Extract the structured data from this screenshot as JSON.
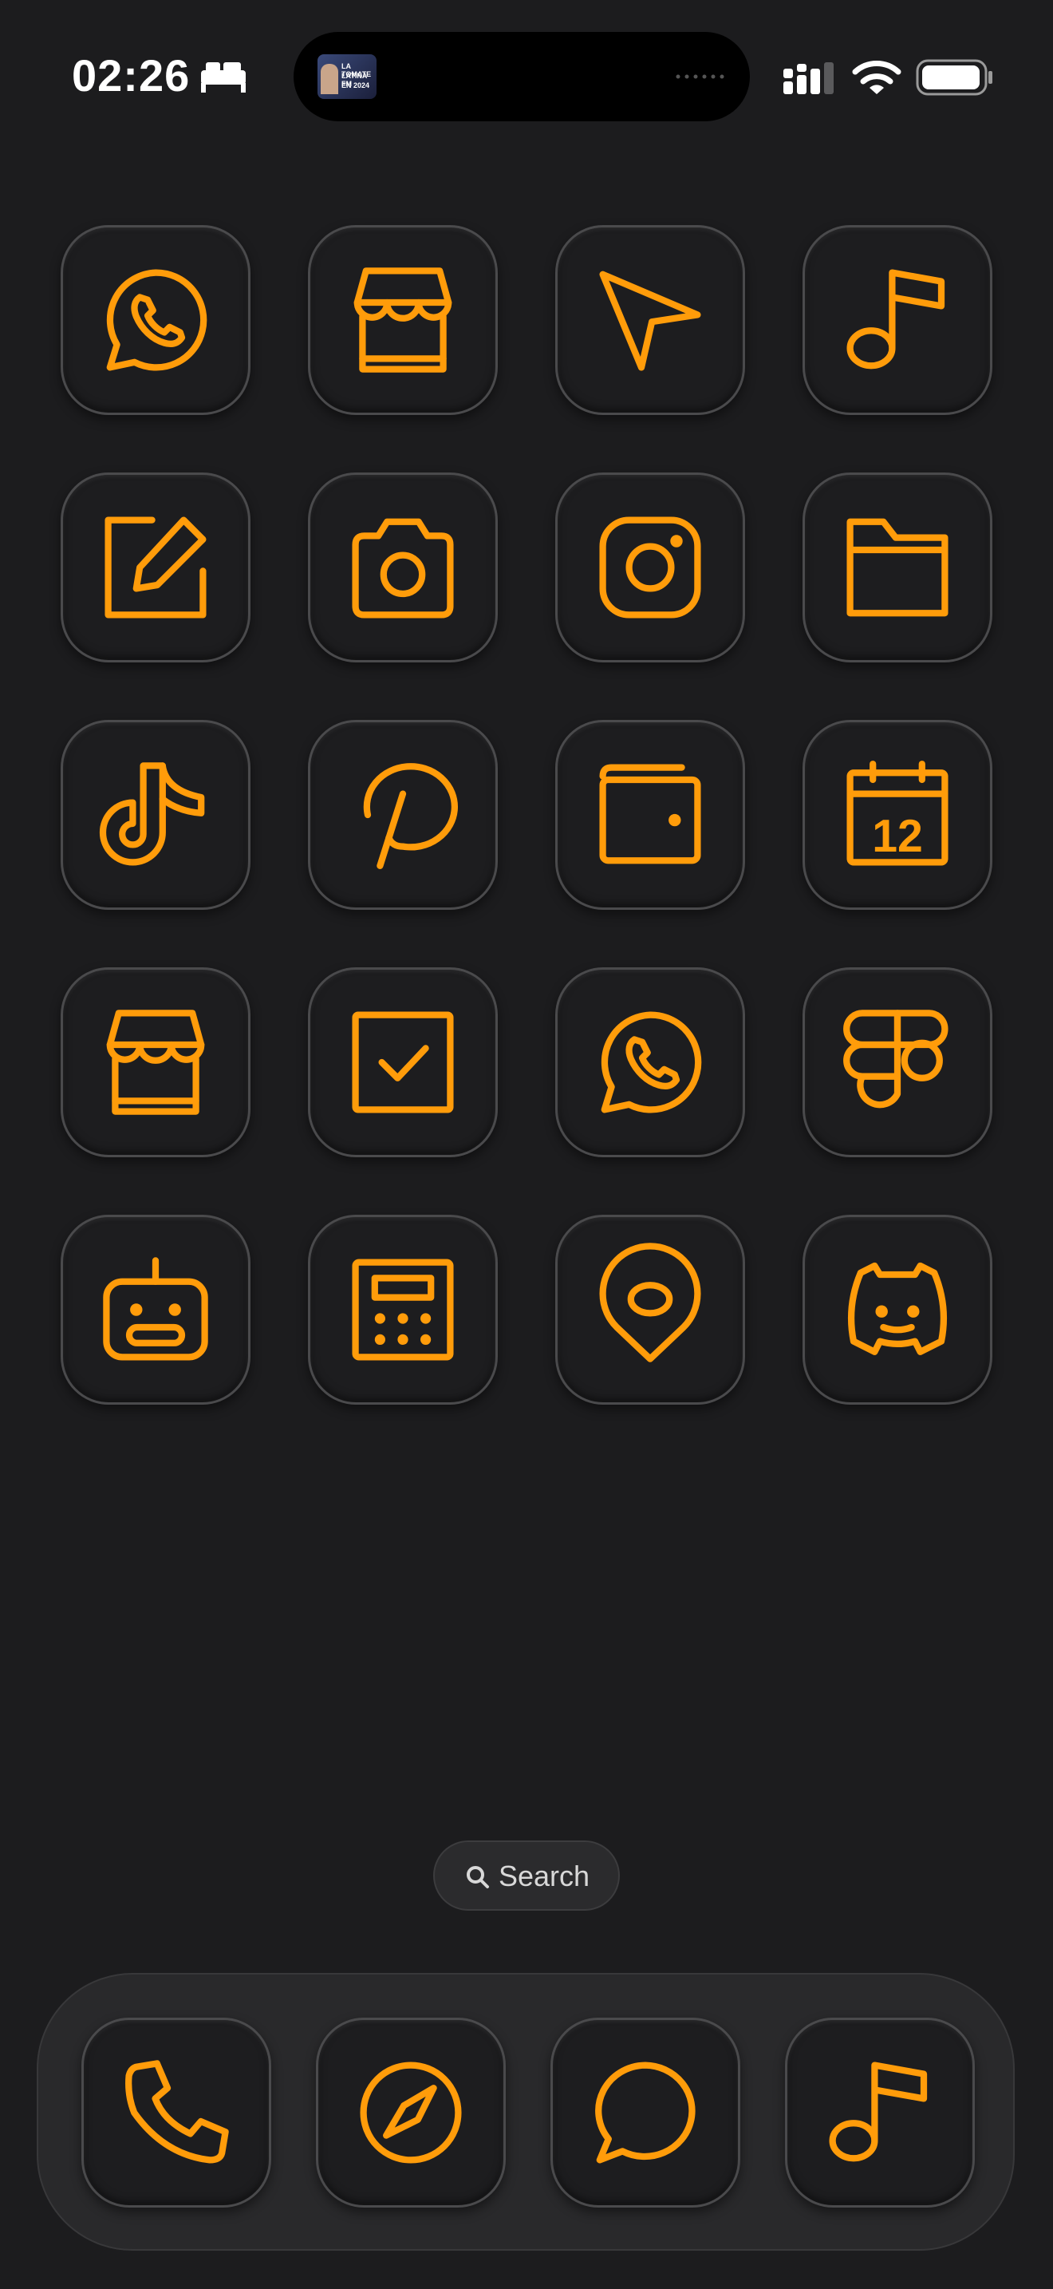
{
  "status_bar": {
    "time": "02:26",
    "sleep_icon": "bed-icon",
    "island_art_text": [
      "LA TOMATE",
      "LATINA FM",
      "EN 2024"
    ],
    "cellular_icon": "signal-icon",
    "wifi_icon": "wifi-icon",
    "battery_icon": "battery-icon"
  },
  "accent_color": "#ff9c0a",
  "home_apps": [
    {
      "icon": "whatsapp-icon"
    },
    {
      "icon": "store-icon"
    },
    {
      "icon": "location-arrow-icon"
    },
    {
      "icon": "music-note-icon"
    },
    {
      "icon": "notes-edit-icon"
    },
    {
      "icon": "camera-icon"
    },
    {
      "icon": "instagram-icon"
    },
    {
      "icon": "folder-icon"
    },
    {
      "icon": "tiktok-icon"
    },
    {
      "icon": "pinterest-icon"
    },
    {
      "icon": "wallet-icon"
    },
    {
      "icon": "calendar-icon",
      "badge_text": "12"
    },
    {
      "icon": "store-icon"
    },
    {
      "icon": "checkbox-icon"
    },
    {
      "icon": "whatsapp-icon"
    },
    {
      "icon": "figma-icon"
    },
    {
      "icon": "robot-icon"
    },
    {
      "icon": "calculator-icon"
    },
    {
      "icon": "map-pin-icon"
    },
    {
      "icon": "discord-icon"
    }
  ],
  "search": {
    "label": "Search",
    "icon": "search-icon"
  },
  "dock_apps": [
    {
      "icon": "phone-icon"
    },
    {
      "icon": "compass-icon"
    },
    {
      "icon": "message-icon"
    },
    {
      "icon": "music-note-icon"
    }
  ]
}
